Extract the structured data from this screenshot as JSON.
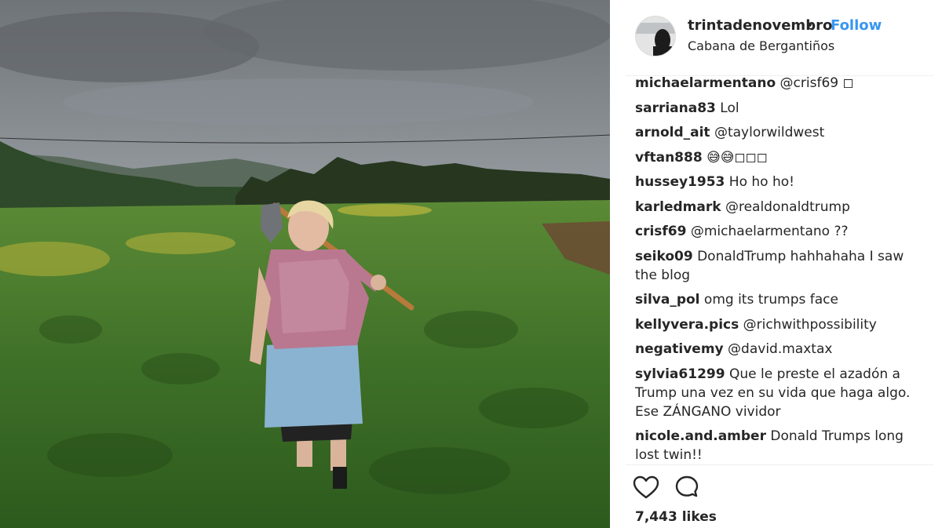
{
  "post": {
    "username": "trintadenovembro",
    "separator": "•",
    "follow_label": "Follow",
    "location": "Cabana de Bergantiños",
    "likes": "7,443 likes"
  },
  "comments": [
    {
      "user": "michaelarmentano",
      "text": "@crisf69 ◻"
    },
    {
      "user": "sarriana83",
      "text": "Lol"
    },
    {
      "user": "arnold_ait",
      "text": "@taylorwildwest"
    },
    {
      "user": "vftan888",
      "text": "😅😅◻◻◻"
    },
    {
      "user": "hussey1953",
      "text": "Ho ho ho!"
    },
    {
      "user": "karledmark",
      "text": "@realdonaldtrump"
    },
    {
      "user": "crisf69",
      "text": "@michaelarmentano ??"
    },
    {
      "user": "seiko09",
      "text": "DonaldTrump hahhahaha I saw the blog"
    },
    {
      "user": "silva_pol",
      "text": "omg its trumps face"
    },
    {
      "user": "kellyvera.pics",
      "text": "@richwithpossibility"
    },
    {
      "user": "negativemy",
      "text": "@david.maxtax"
    },
    {
      "user": "sylvia61299",
      "text": "Que le preste el azadón a Trump una vez en su vida que haga algo. Ese ZÁNGANO vividor"
    },
    {
      "user": "nicole.and.amber",
      "text": "Donald Trumps long lost twin!!"
    }
  ],
  "icons": {
    "like": "heart-icon",
    "comment": "comment-icon"
  },
  "colors": {
    "link": "#3897f0",
    "text": "#262626"
  }
}
